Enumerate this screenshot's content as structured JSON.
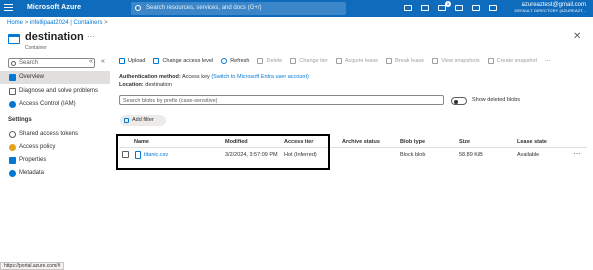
{
  "topbar": {
    "brand": "Microsoft Azure",
    "search_placeholder": "Search resources, services, and docs (G+/)",
    "notification_count": "1",
    "user_email": "azureaztest@gmail.com",
    "user_directory": "DEFAULT DIRECTORY (AZUREAZT..."
  },
  "breadcrumb": {
    "home": "Home",
    "sep1": ">",
    "account": "infellipaat2024 | Containers",
    "sep2": ">"
  },
  "header": {
    "title": "destination",
    "subtitle": "Container",
    "more": "···",
    "close": "✕"
  },
  "sidebar": {
    "search_placeholder": "Search",
    "collapse": "«",
    "expand": "«",
    "items": [
      {
        "label": "Overview"
      },
      {
        "label": "Diagnose and solve problems"
      },
      {
        "label": "Access Control (IAM)"
      }
    ],
    "settings_heading": "Settings",
    "settings_items": [
      {
        "label": "Shared access tokens"
      },
      {
        "label": "Access policy"
      },
      {
        "label": "Properties"
      },
      {
        "label": "Metadata"
      }
    ]
  },
  "toolbar": {
    "upload": "Upload",
    "change_access": "Change access level",
    "refresh": "Refresh",
    "delete": "Delete",
    "change_tier": "Change tier",
    "acquire_lease": "Acquire lease",
    "break_lease": "Break lease",
    "view_snapshots": "View snapshots",
    "create_snapshot": "Create snapshot",
    "more": "···"
  },
  "auth": {
    "method_label": "Authentication method:",
    "method_value": "Access key",
    "switch_link": "(Switch to Microsoft Entra user account)",
    "location_label": "Location:",
    "location_value": "destination"
  },
  "filter": {
    "search_placeholder": "Search blobs by prefix (case-sensitive)",
    "show_deleted": "Show deleted blobs",
    "add_filter": "Add filter"
  },
  "table": {
    "headers": [
      "Name",
      "Modified",
      "Access tier",
      "Archive status",
      "Blob type",
      "Size",
      "Lease state"
    ],
    "rows": [
      {
        "name": "titanic.csv",
        "modified": "3/2/2024, 3:57:09 PM",
        "access_tier": "Hot (Inferred)",
        "archive_status": "",
        "blob_type": "Block blob",
        "size": "58.89 KiB",
        "lease_state": "Available",
        "more": "···"
      }
    ]
  },
  "statusbar": {
    "url": "https://portal.azure.com/#"
  }
}
